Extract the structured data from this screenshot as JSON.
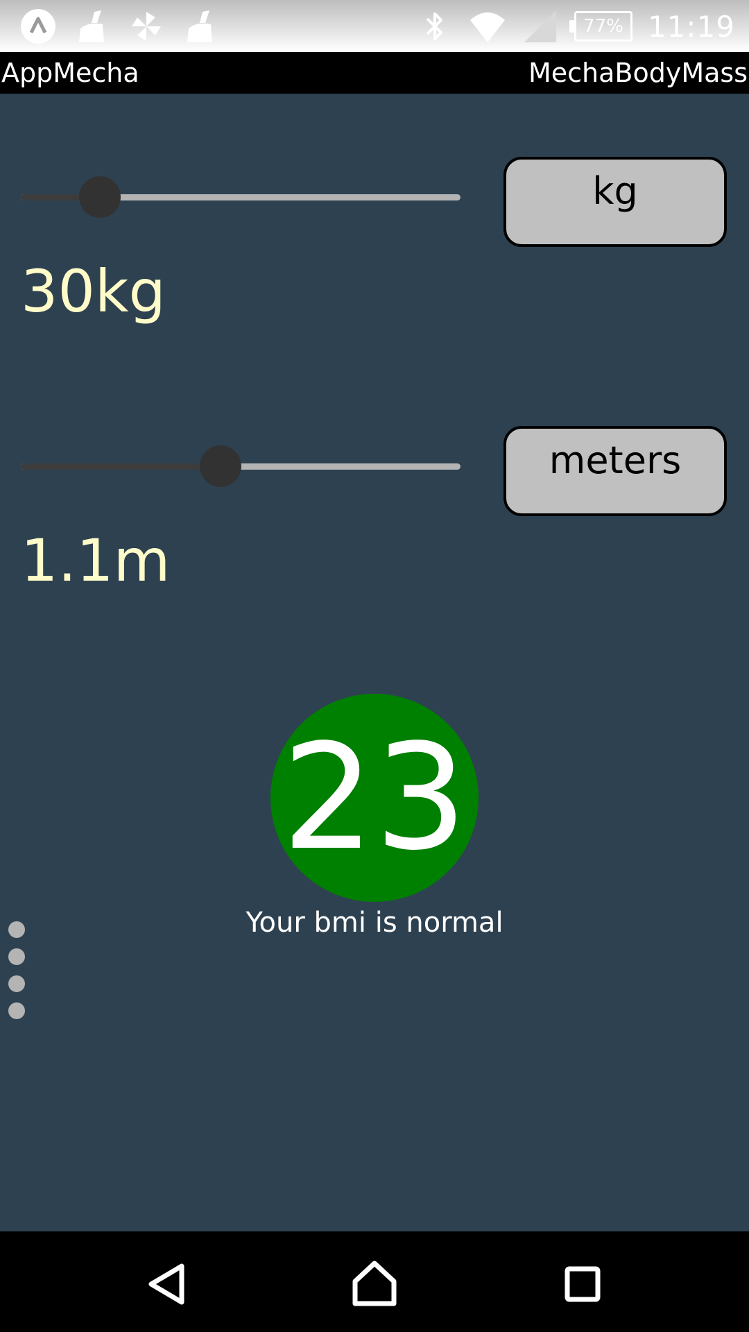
{
  "status_bar": {
    "left_icons": [
      "app-a-icon",
      "cleaner-icon",
      "pinwheel-icon",
      "cleaner-icon"
    ],
    "right_icons": [
      "bluetooth-icon",
      "wifi-icon",
      "cell-signal-icon"
    ],
    "battery": "77%",
    "time": "11:19"
  },
  "title_bar": {
    "app_name": "AppMecha",
    "screen_name": "MechaBodyMass"
  },
  "weight": {
    "slider_fraction": 0.18,
    "unit_label": "kg",
    "value_text": "30kg"
  },
  "height": {
    "slider_fraction": 0.455,
    "unit_label": "meters",
    "value_text": "1.1m"
  },
  "bmi": {
    "value": "23",
    "message": "Your bmi is normal",
    "status_color": "#008000"
  },
  "page_indicator": {
    "dot_count": 4
  },
  "nav_bar": {
    "icons": [
      "back-icon",
      "home-icon",
      "recents-icon"
    ]
  },
  "colors": {
    "background": "#2e4150",
    "readout_text": "#fffcc9",
    "button_fill": "#c0c0c0"
  }
}
